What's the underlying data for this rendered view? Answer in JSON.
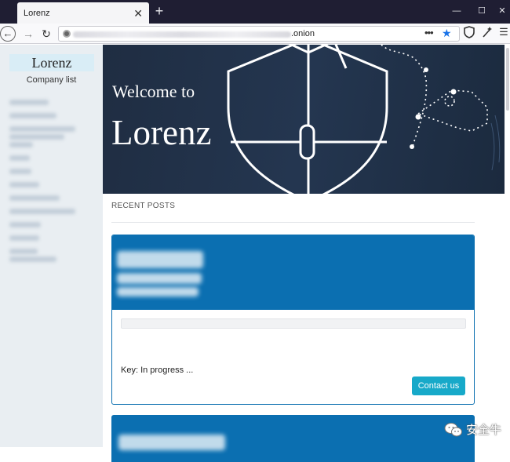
{
  "browser": {
    "tab_title": "Lorenz",
    "tab_close": "✕",
    "new_tab": "+",
    "window_controls": [
      "—",
      "☐",
      "✕"
    ],
    "url_suffix": ".onion",
    "url_menu": "•••",
    "bookmark_star": "★"
  },
  "sidebar": {
    "title": "Lorenz",
    "subtitle": "Company list"
  },
  "hero": {
    "welcome": "Welcome to",
    "brand": "Lorenz"
  },
  "section": {
    "recent_posts": "RECENT POSTS"
  },
  "card": {
    "key_status": "Key: In progress ...",
    "contact_button": "Contact us"
  },
  "watermark": {
    "text": "安全牛"
  }
}
